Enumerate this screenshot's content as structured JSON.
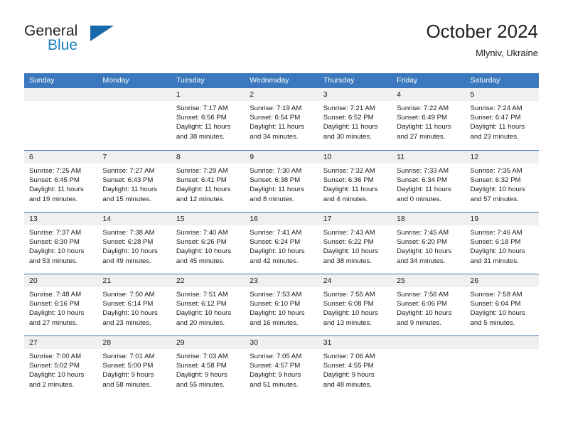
{
  "logo": {
    "word1": "General",
    "word2": "Blue",
    "triangle_color": "#1769ab",
    "blue_color": "#1a7fc1"
  },
  "header": {
    "title": "October 2024",
    "subtitle": "Mlyniv, Ukraine"
  },
  "colors": {
    "header_blue": "#3b78bd",
    "day_band_gray": "#f0f0f0",
    "text": "#1a1a1a"
  },
  "weekdays": [
    "Sunday",
    "Monday",
    "Tuesday",
    "Wednesday",
    "Thursday",
    "Friday",
    "Saturday"
  ],
  "weeks": [
    [
      {
        "day": "",
        "empty": true
      },
      {
        "day": "",
        "empty": true
      },
      {
        "day": "1",
        "sunrise": "Sunrise: 7:17 AM",
        "sunset": "Sunset: 6:56 PM",
        "daylight1": "Daylight: 11 hours",
        "daylight2": "and 38 minutes."
      },
      {
        "day": "2",
        "sunrise": "Sunrise: 7:19 AM",
        "sunset": "Sunset: 6:54 PM",
        "daylight1": "Daylight: 11 hours",
        "daylight2": "and 34 minutes."
      },
      {
        "day": "3",
        "sunrise": "Sunrise: 7:21 AM",
        "sunset": "Sunset: 6:52 PM",
        "daylight1": "Daylight: 11 hours",
        "daylight2": "and 30 minutes."
      },
      {
        "day": "4",
        "sunrise": "Sunrise: 7:22 AM",
        "sunset": "Sunset: 6:49 PM",
        "daylight1": "Daylight: 11 hours",
        "daylight2": "and 27 minutes."
      },
      {
        "day": "5",
        "sunrise": "Sunrise: 7:24 AM",
        "sunset": "Sunset: 6:47 PM",
        "daylight1": "Daylight: 11 hours",
        "daylight2": "and 23 minutes."
      }
    ],
    [
      {
        "day": "6",
        "sunrise": "Sunrise: 7:25 AM",
        "sunset": "Sunset: 6:45 PM",
        "daylight1": "Daylight: 11 hours",
        "daylight2": "and 19 minutes."
      },
      {
        "day": "7",
        "sunrise": "Sunrise: 7:27 AM",
        "sunset": "Sunset: 6:43 PM",
        "daylight1": "Daylight: 11 hours",
        "daylight2": "and 15 minutes."
      },
      {
        "day": "8",
        "sunrise": "Sunrise: 7:29 AM",
        "sunset": "Sunset: 6:41 PM",
        "daylight1": "Daylight: 11 hours",
        "daylight2": "and 12 minutes."
      },
      {
        "day": "9",
        "sunrise": "Sunrise: 7:30 AM",
        "sunset": "Sunset: 6:38 PM",
        "daylight1": "Daylight: 11 hours",
        "daylight2": "and 8 minutes."
      },
      {
        "day": "10",
        "sunrise": "Sunrise: 7:32 AM",
        "sunset": "Sunset: 6:36 PM",
        "daylight1": "Daylight: 11 hours",
        "daylight2": "and 4 minutes."
      },
      {
        "day": "11",
        "sunrise": "Sunrise: 7:33 AM",
        "sunset": "Sunset: 6:34 PM",
        "daylight1": "Daylight: 11 hours",
        "daylight2": "and 0 minutes."
      },
      {
        "day": "12",
        "sunrise": "Sunrise: 7:35 AM",
        "sunset": "Sunset: 6:32 PM",
        "daylight1": "Daylight: 10 hours",
        "daylight2": "and 57 minutes."
      }
    ],
    [
      {
        "day": "13",
        "sunrise": "Sunrise: 7:37 AM",
        "sunset": "Sunset: 6:30 PM",
        "daylight1": "Daylight: 10 hours",
        "daylight2": "and 53 minutes."
      },
      {
        "day": "14",
        "sunrise": "Sunrise: 7:38 AM",
        "sunset": "Sunset: 6:28 PM",
        "daylight1": "Daylight: 10 hours",
        "daylight2": "and 49 minutes."
      },
      {
        "day": "15",
        "sunrise": "Sunrise: 7:40 AM",
        "sunset": "Sunset: 6:26 PM",
        "daylight1": "Daylight: 10 hours",
        "daylight2": "and 45 minutes."
      },
      {
        "day": "16",
        "sunrise": "Sunrise: 7:41 AM",
        "sunset": "Sunset: 6:24 PM",
        "daylight1": "Daylight: 10 hours",
        "daylight2": "and 42 minutes."
      },
      {
        "day": "17",
        "sunrise": "Sunrise: 7:43 AM",
        "sunset": "Sunset: 6:22 PM",
        "daylight1": "Daylight: 10 hours",
        "daylight2": "and 38 minutes."
      },
      {
        "day": "18",
        "sunrise": "Sunrise: 7:45 AM",
        "sunset": "Sunset: 6:20 PM",
        "daylight1": "Daylight: 10 hours",
        "daylight2": "and 34 minutes."
      },
      {
        "day": "19",
        "sunrise": "Sunrise: 7:46 AM",
        "sunset": "Sunset: 6:18 PM",
        "daylight1": "Daylight: 10 hours",
        "daylight2": "and 31 minutes."
      }
    ],
    [
      {
        "day": "20",
        "sunrise": "Sunrise: 7:48 AM",
        "sunset": "Sunset: 6:16 PM",
        "daylight1": "Daylight: 10 hours",
        "daylight2": "and 27 minutes."
      },
      {
        "day": "21",
        "sunrise": "Sunrise: 7:50 AM",
        "sunset": "Sunset: 6:14 PM",
        "daylight1": "Daylight: 10 hours",
        "daylight2": "and 23 minutes."
      },
      {
        "day": "22",
        "sunrise": "Sunrise: 7:51 AM",
        "sunset": "Sunset: 6:12 PM",
        "daylight1": "Daylight: 10 hours",
        "daylight2": "and 20 minutes."
      },
      {
        "day": "23",
        "sunrise": "Sunrise: 7:53 AM",
        "sunset": "Sunset: 6:10 PM",
        "daylight1": "Daylight: 10 hours",
        "daylight2": "and 16 minutes."
      },
      {
        "day": "24",
        "sunrise": "Sunrise: 7:55 AM",
        "sunset": "Sunset: 6:08 PM",
        "daylight1": "Daylight: 10 hours",
        "daylight2": "and 13 minutes."
      },
      {
        "day": "25",
        "sunrise": "Sunrise: 7:56 AM",
        "sunset": "Sunset: 6:06 PM",
        "daylight1": "Daylight: 10 hours",
        "daylight2": "and 9 minutes."
      },
      {
        "day": "26",
        "sunrise": "Sunrise: 7:58 AM",
        "sunset": "Sunset: 6:04 PM",
        "daylight1": "Daylight: 10 hours",
        "daylight2": "and 5 minutes."
      }
    ],
    [
      {
        "day": "27",
        "sunrise": "Sunrise: 7:00 AM",
        "sunset": "Sunset: 5:02 PM",
        "daylight1": "Daylight: 10 hours",
        "daylight2": "and 2 minutes."
      },
      {
        "day": "28",
        "sunrise": "Sunrise: 7:01 AM",
        "sunset": "Sunset: 5:00 PM",
        "daylight1": "Daylight: 9 hours",
        "daylight2": "and 58 minutes."
      },
      {
        "day": "29",
        "sunrise": "Sunrise: 7:03 AM",
        "sunset": "Sunset: 4:58 PM",
        "daylight1": "Daylight: 9 hours",
        "daylight2": "and 55 minutes."
      },
      {
        "day": "30",
        "sunrise": "Sunrise: 7:05 AM",
        "sunset": "Sunset: 4:57 PM",
        "daylight1": "Daylight: 9 hours",
        "daylight2": "and 51 minutes."
      },
      {
        "day": "31",
        "sunrise": "Sunrise: 7:06 AM",
        "sunset": "Sunset: 4:55 PM",
        "daylight1": "Daylight: 9 hours",
        "daylight2": "and 48 minutes."
      },
      {
        "day": "",
        "empty": true
      },
      {
        "day": "",
        "empty": true
      }
    ]
  ]
}
